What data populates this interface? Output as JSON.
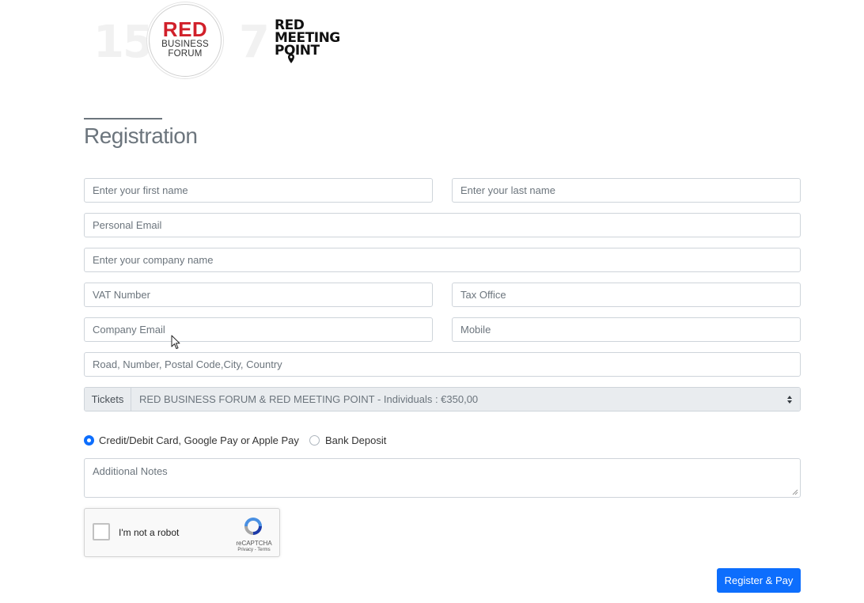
{
  "logos": {
    "left_number": "15",
    "forum_title": "RED",
    "forum_line1": "BUSINESS",
    "forum_line2": "FORUM",
    "right_number": "7",
    "meeting_line1": "RED",
    "meeting_line2": "MEETING",
    "meeting_line3": "POINT"
  },
  "heading": "Registration",
  "form": {
    "first_name": {
      "placeholder": "Enter your first name",
      "value": ""
    },
    "last_name": {
      "placeholder": "Enter your last name",
      "value": ""
    },
    "personal_email": {
      "placeholder": "Personal Email",
      "value": ""
    },
    "company_name": {
      "placeholder": "Enter your company name",
      "value": ""
    },
    "vat_number": {
      "placeholder": "VAT Number",
      "value": ""
    },
    "tax_office": {
      "placeholder": "Tax Office",
      "value": ""
    },
    "company_email": {
      "placeholder": "Company Email",
      "value": ""
    },
    "mobile": {
      "placeholder": "Mobile",
      "value": ""
    },
    "address": {
      "placeholder": "Road, Number, Postal Code,City, Country",
      "value": ""
    },
    "tickets": {
      "label": "Tickets",
      "selected": "RED BUSINESS FORUM & RED MEETING POINT - Individuals : €350,00"
    },
    "payment": {
      "options": [
        {
          "label": "Credit/Debit Card, Google Pay or Apple Pay",
          "checked": true
        },
        {
          "label": "Bank Deposit",
          "checked": false
        }
      ]
    },
    "notes": {
      "placeholder": "Additional Notes",
      "value": ""
    },
    "captcha": {
      "label": "I'm not a robot",
      "brand": "reCAPTCHA",
      "links": "Privacy - Terms"
    },
    "submit_label": "Register & Pay"
  },
  "colors": {
    "accent": "#0d6efd",
    "brand_red": "#d1202a",
    "heading": "#6c757d",
    "border": "#ced4da"
  }
}
